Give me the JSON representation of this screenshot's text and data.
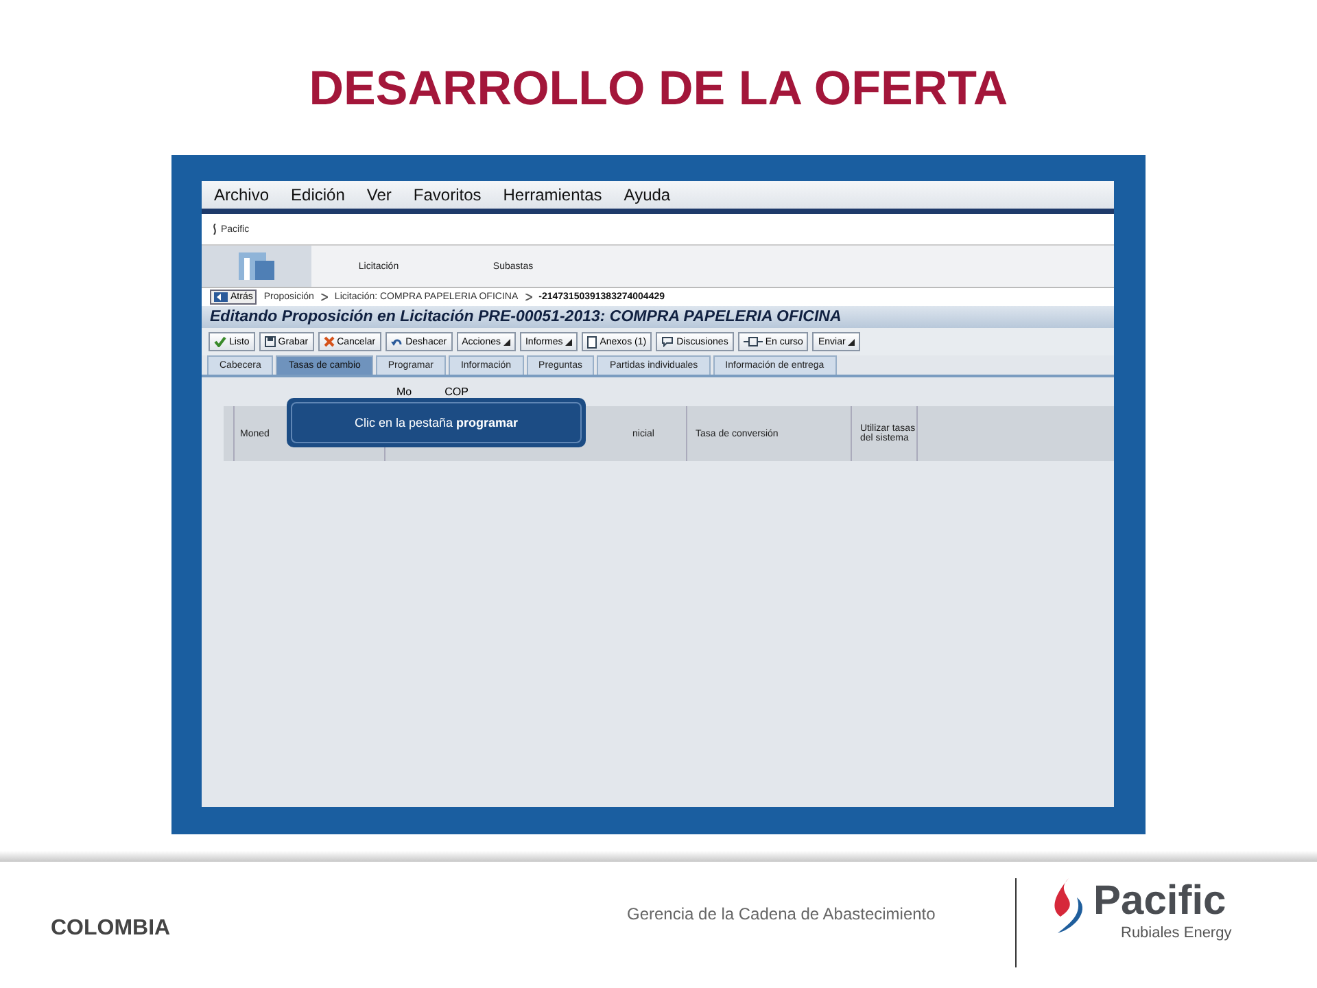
{
  "slide_title": "DESARROLLO DE LA OFERTA",
  "screen": {
    "menu": [
      "Archivo",
      "Edición",
      "Ver",
      "Favoritos",
      "Herramientas",
      "Ayuda"
    ],
    "app_logo": "Pacific",
    "nav_tabs": [
      "Licitación",
      "Subastas"
    ],
    "back_button": "Atrás",
    "breadcrumb": [
      "Proposición",
      "Licitación: COMPRA PAPELERIA OFICINA",
      "-21473150391383274004429"
    ],
    "page_title": "Editando Proposición en Licitación PRE-00051-2013: COMPRA PAPELERIA OFICINA",
    "toolbar": [
      {
        "label": "Listo",
        "kind": "check",
        "dropdown": false
      },
      {
        "label": "Grabar",
        "kind": "save",
        "dropdown": false
      },
      {
        "label": "Cancelar",
        "kind": "cancel",
        "dropdown": false
      },
      {
        "label": "Deshacer",
        "kind": "undo",
        "dropdown": false
      },
      {
        "label": "Acciones",
        "kind": "menu",
        "dropdown": true
      },
      {
        "label": "Informes",
        "kind": "menu",
        "dropdown": true
      },
      {
        "label": "Anexos (1)",
        "kind": "doc",
        "dropdown": false
      },
      {
        "label": "Discusiones",
        "kind": "bubble",
        "dropdown": false
      },
      {
        "label": "En curso",
        "kind": "flow",
        "dropdown": false
      },
      {
        "label": "Enviar",
        "kind": "menu",
        "dropdown": true
      }
    ],
    "tabs": [
      {
        "label": "Cabecera",
        "selected": false
      },
      {
        "label": "Tasas de cambio",
        "selected": true
      },
      {
        "label": "Programar",
        "selected": false
      },
      {
        "label": "Información",
        "selected": false
      },
      {
        "label": "Preguntas",
        "selected": false
      },
      {
        "label": "Partidas individuales",
        "selected": false
      },
      {
        "label": "Información de entrega",
        "selected": false
      }
    ],
    "currency_label": "Mo",
    "currency_value": "COP",
    "columns": [
      "Moned",
      "nicial",
      "Tasa de conversión",
      "Utilizar tasas del sistema"
    ],
    "tooltip": {
      "before": "Clic en la pestaña ",
      "bold": "programar"
    }
  },
  "footer": {
    "country": "COLOMBIA",
    "department": "Gerencia de la Cadena de Abastecimiento",
    "logo_name": "Pacific",
    "logo_sub": "Rubiales Energy"
  }
}
